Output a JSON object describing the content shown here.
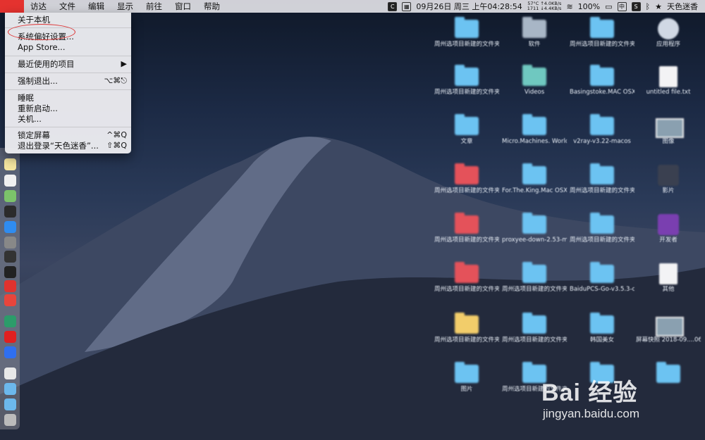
{
  "menubar": {
    "items": [
      "访达",
      "文件",
      "编辑",
      "显示",
      "前往",
      "窗口",
      "帮助"
    ],
    "status": {
      "c_icon": "C",
      "date_time": "09月26日 周三 上午04:28:54",
      "temp": "57°C ↑4.0KB/s",
      "net": "1711 ↓4.4KB/s",
      "battery": "100%",
      "input_method": "中",
      "s_icon": "S",
      "user": "天色迷香"
    }
  },
  "apple_menu": {
    "items": [
      {
        "label": "关于本机",
        "shortcut": ""
      },
      {
        "label": "系统偏好设置...",
        "shortcut": ""
      },
      {
        "label": "App Store...",
        "shortcut": ""
      },
      {
        "label": "最近使用的项目",
        "shortcut": "▶"
      },
      {
        "label": "强制退出...",
        "shortcut": "⌥⌘⎋"
      },
      {
        "label": "睡眠",
        "shortcut": ""
      },
      {
        "label": "重新启动...",
        "shortcut": ""
      },
      {
        "label": "关机...",
        "shortcut": ""
      },
      {
        "label": "锁定屏幕",
        "shortcut": "^⌘Q"
      },
      {
        "label": "退出登录“天色迷香”...",
        "shortcut": "⇧⌘Q"
      }
    ]
  },
  "dock": {
    "icons": [
      "notes-icon",
      "file-icon",
      "maps-icon",
      "terminal-icon",
      "app-store-icon",
      "disk-utility-icon",
      "activity-monitor-icon",
      "console-icon",
      "vivaldi-icon",
      "yandex-icon",
      "android-file-icon",
      "netease-music-icon",
      "baidu-netdisk-icon",
      "preview-icon",
      "folder-icon",
      "downloads-icon",
      "trash-icon"
    ]
  },
  "desktop": {
    "icons": [
      {
        "label": "周州选项目新建的文件夹 7",
        "kind": "folder"
      },
      {
        "label": "软件",
        "kind": "folder-gray"
      },
      {
        "label": "周州选项目新建的文件夹 14",
        "kind": "folder"
      },
      {
        "label": "应用程序",
        "kind": "app"
      },
      {
        "label": "周州选项目新建的文件夹 3",
        "kind": "folder"
      },
      {
        "label": "Videos",
        "kind": "folder-teal"
      },
      {
        "label": "Basingstoke.MAC OSX-GOG",
        "kind": "folder"
      },
      {
        "label": "untitled file.txt",
        "kind": "file"
      },
      {
        "label": "文章",
        "kind": "folder"
      },
      {
        "label": "Micro.Machines. World.S...TIVATED",
        "kind": "folder"
      },
      {
        "label": "v2ray-v3.22-macos",
        "kind": "folder"
      },
      {
        "label": "图像",
        "kind": "image"
      },
      {
        "label": "周州选项目新建的文件夹 6",
        "kind": "folder-red"
      },
      {
        "label": "For.The.King.Mac OSX-ACTIVATED",
        "kind": "folder"
      },
      {
        "label": "周州选项目新建的文件夹 13",
        "kind": "folder"
      },
      {
        "label": "影片",
        "kind": "app-dark"
      },
      {
        "label": "周州选项目新建的文件夹 5",
        "kind": "folder-red"
      },
      {
        "label": "proxyee-down-2.53-mac",
        "kind": "folder"
      },
      {
        "label": "周州选项目新建的文件夹 12",
        "kind": "folder"
      },
      {
        "label": "开发者",
        "kind": "app-purple"
      },
      {
        "label": "周州选项目新建的文件夹 4",
        "kind": "folder-red"
      },
      {
        "label": "周州选项目新建的文件夹 10",
        "kind": "folder"
      },
      {
        "label": "BaiduPCS-Go-v3.5.3-d...-amd64",
        "kind": "folder"
      },
      {
        "label": "其他",
        "kind": "file"
      },
      {
        "label": "周州选项目新建的文件夹 2",
        "kind": "folder-yellow"
      },
      {
        "label": "周州选项目新建的文件夹 9",
        "kind": "folder"
      },
      {
        "label": "韩国美女",
        "kind": "folder"
      },
      {
        "label": "屏幕快照 2018-09....06.png",
        "kind": "image"
      },
      {
        "label": "图片",
        "kind": "folder"
      },
      {
        "label": "周州选项目新建的文件夹",
        "kind": "folder"
      },
      {
        "label": "",
        "kind": "folder"
      },
      {
        "label": "",
        "kind": "folder"
      }
    ]
  },
  "watermark": {
    "brand": "Bai 经验",
    "url": "jingyan.baidu.com"
  }
}
